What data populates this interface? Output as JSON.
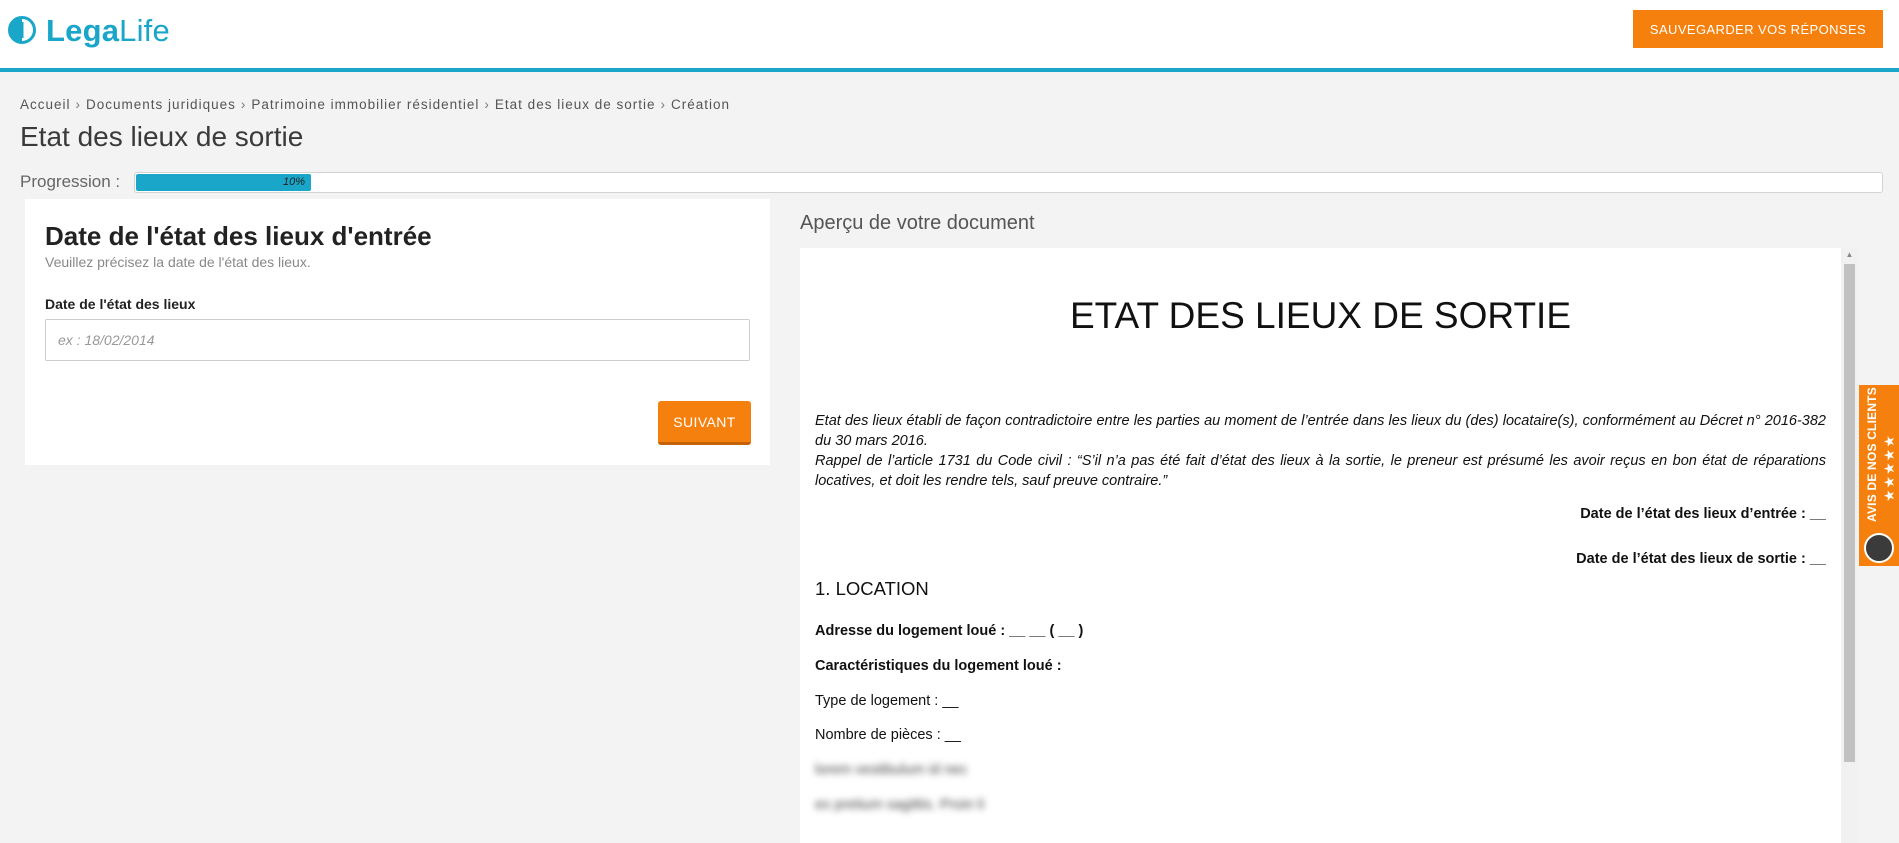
{
  "header": {
    "logo_part1": "Lega",
    "logo_part2": "Life",
    "save_label": "SAUVEGARDER VOS RÉPONSES"
  },
  "breadcrumb": [
    "Accueil",
    "Documents juridiques",
    "Patrimoine immobilier résidentiel",
    "Etat des lieux de sortie",
    "Création"
  ],
  "breadcrumb_separator": "›",
  "page_title": "Etat des lieux de sortie",
  "progress": {
    "label": "Progression :",
    "value": 0.1,
    "text": "10%"
  },
  "form": {
    "title": "Date de l'état des lieux d'entrée",
    "subtitle": "Veuillez précisez la date de l'état des lieux.",
    "field_label": "Date de l'état des lieux",
    "field_value": "",
    "field_placeholder": "ex : 18/02/2014",
    "next_label": "SUIVANT"
  },
  "preview": {
    "heading": "Aperçu de votre document",
    "doc_title": "ETAT DES LIEUX DE SORTIE",
    "intro_1": "Etat des lieux établi de façon contradictoire entre les parties au moment de l’entrée dans les lieux du (des) locataire(s), conformément au Décret n° 2016-382 du 30 mars 2016.",
    "intro_2": "Rappel de l’article 1731 du Code civil : “S’il n’a pas été fait d’état des lieux à la sortie, le preneur est présumé les avoir reçus en bon état de réparations locatives, et doit les rendre tels, sauf preuve contraire.”",
    "date_entree": "Date de l’état des lieux d’entrée : __",
    "date_sortie": "Date de l’état des lieux de sortie : __",
    "section_1": "1. LOCATION",
    "adresse": "Adresse du logement loué : __ __ ( __ )",
    "caracteristiques": "Caractéristiques du logement loué :",
    "type_logement": "Type de logement : __",
    "nombre_pieces": "Nombre de pièces : __",
    "blurred_1": "lorem vestibulum id nec",
    "blurred_2": "ex pretium sagittis. Proin li"
  },
  "reviews_tab": {
    "text": "AVIS DE NOS CLIENTS",
    "stars": "★★★★★"
  },
  "colors": {
    "accent_blue": "#1aa6c9",
    "accent_orange": "#f5800d"
  }
}
